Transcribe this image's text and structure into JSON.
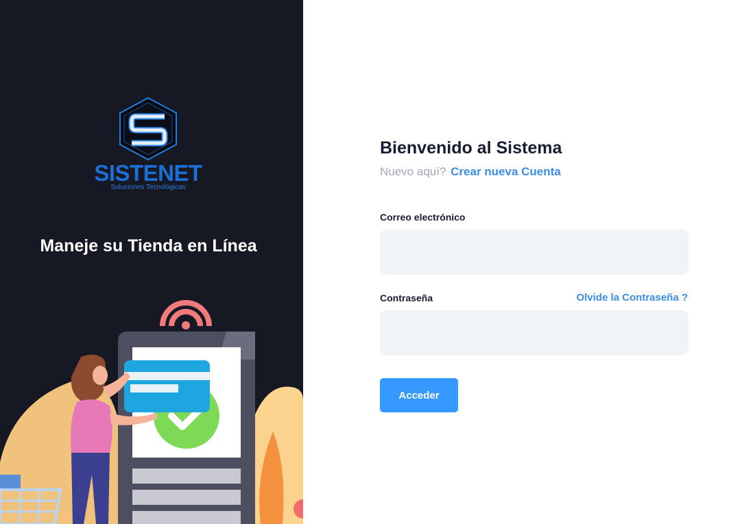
{
  "brand": {
    "name": "SISTENET",
    "tagline": "Soluciones Tecnológicas",
    "logo_icon": "hexagon-s-logo-icon",
    "primary_color": "#1b6fd6"
  },
  "aside": {
    "heading": "Maneje su Tienda en Línea",
    "background": "#161823",
    "illustration": "online-store-payment-illustration"
  },
  "form": {
    "title": "Bienvenido al Sistema",
    "new_here": "Nuevo aquí?",
    "create_account": "Crear nueva Cuenta",
    "email_label": "Correo electrónico",
    "email_value": "",
    "password_label": "Contraseña",
    "password_value": "",
    "forgot_password": "Olvide la Contraseña ?",
    "submit_label": "Acceder",
    "accent_color": "#3699ff"
  }
}
